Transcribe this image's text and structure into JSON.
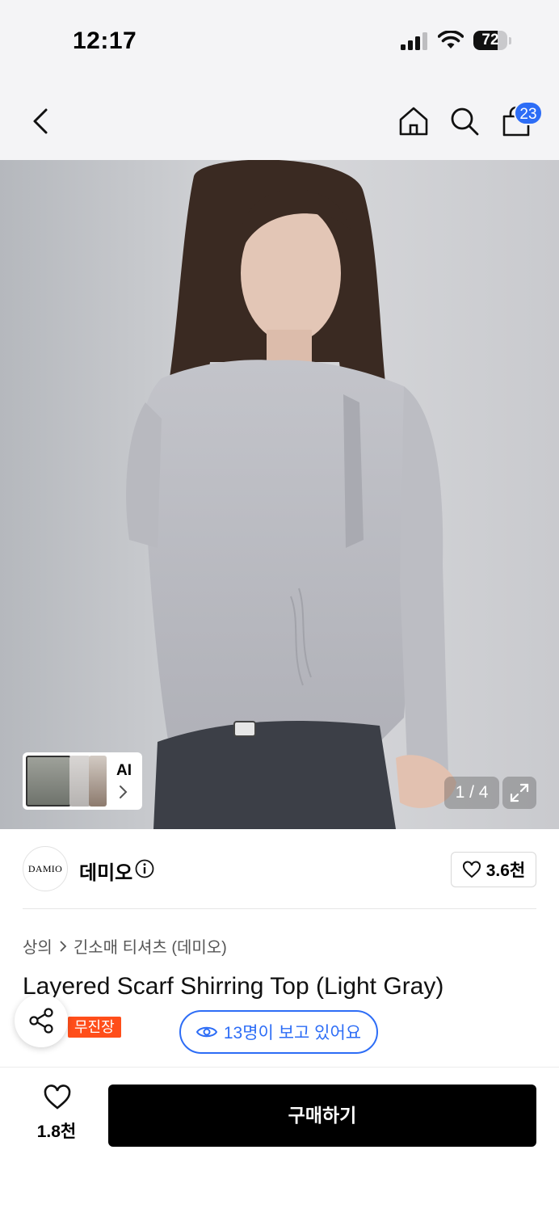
{
  "status_bar": {
    "time": "12:17",
    "battery": "72",
    "battery_level": 0.72
  },
  "nav": {
    "back_icon": "chevron-left-icon",
    "home_icon": "home-icon",
    "search_icon": "search-icon",
    "cart_icon": "shopping-bag-icon",
    "cart_count": "23"
  },
  "gallery": {
    "ai_label": "AI",
    "counter": "1 / 4"
  },
  "brand": {
    "logo_text": "DAMIO",
    "name": "데미오",
    "likes": "3.6천"
  },
  "product": {
    "breadcrumb": [
      "상의",
      "긴소매 티셔츠 (데미오)"
    ],
    "title": "Layered Scarf Shirring Top (Light Gray)",
    "tag": "무진장",
    "viewers": "13명이 보고 있어요"
  },
  "bottom_bar": {
    "wish_count": "1.8천",
    "buy_label": "구매하기"
  },
  "colors": {
    "accent": "#2d6df6",
    "tag": "#ff4e1a",
    "buy_button": "#000000"
  }
}
